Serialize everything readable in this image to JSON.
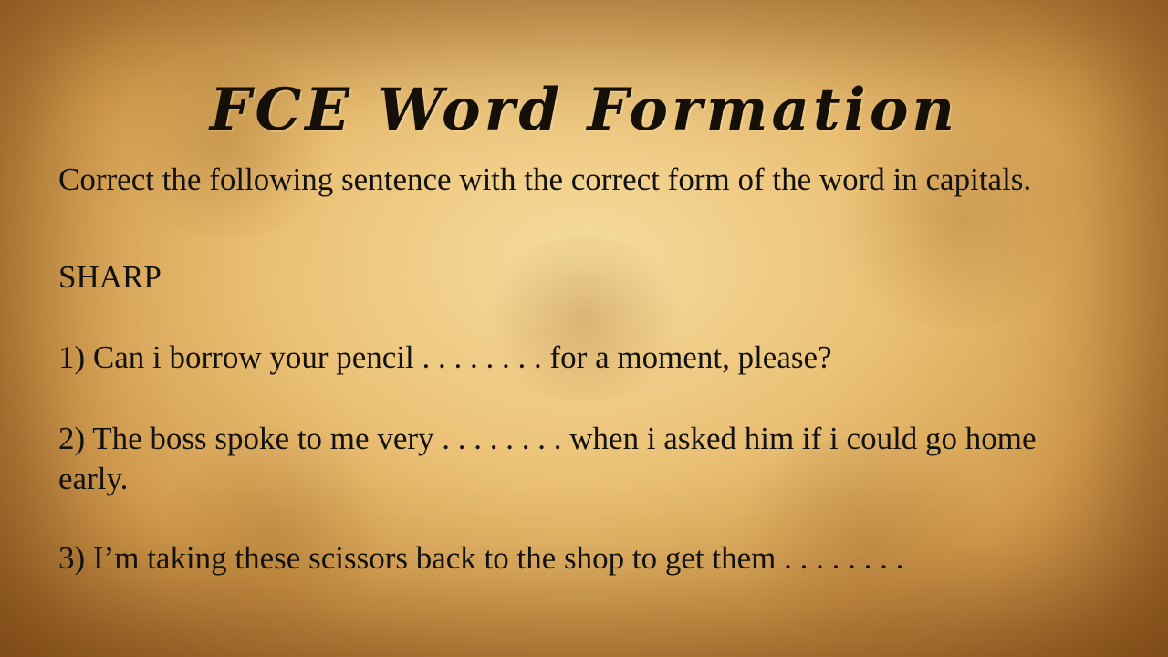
{
  "slide": {
    "title": "FCE Word Formation",
    "instruction": "Correct the following  sentence with the correct form of the word in capitals.",
    "keyword": "SHARP",
    "questions": [
      "1) Can i borrow your pencil . . . . . . . . for a moment, please?",
      "2) The boss spoke to me very . . . . . . . . when i asked him if i could go home early.",
      "3) I’m taking these scissors back to the shop to get them . . . . . . . ."
    ]
  },
  "colors": {
    "text": "#121212",
    "parchment": "#e3b46c",
    "edge": "#8c551e"
  }
}
